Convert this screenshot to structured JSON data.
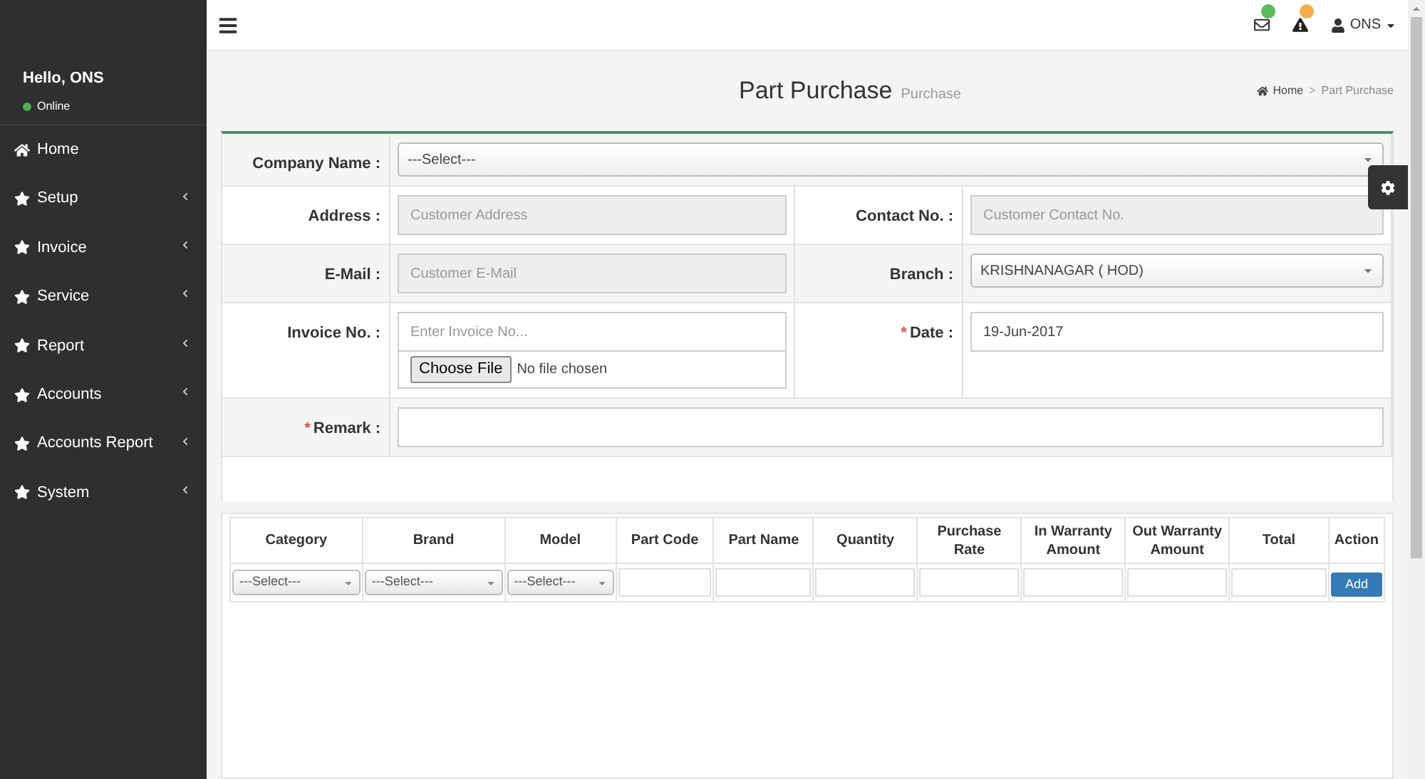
{
  "sidebar": {
    "greeting": "Hello, ONS",
    "status": {
      "label": "Online",
      "color": "#4caf50"
    },
    "items": [
      {
        "label": "Home",
        "kind": "home",
        "expandable": false
      },
      {
        "label": "Setup",
        "kind": "star",
        "expandable": true
      },
      {
        "label": "Invoice",
        "kind": "star",
        "expandable": true
      },
      {
        "label": "Service",
        "kind": "star",
        "expandable": true
      },
      {
        "label": "Report",
        "kind": "star",
        "expandable": true
      },
      {
        "label": "Accounts",
        "kind": "star",
        "expandable": true
      },
      {
        "label": "Accounts Report",
        "kind": "star",
        "expandable": true
      },
      {
        "label": "System",
        "kind": "star",
        "expandable": true
      }
    ]
  },
  "topbar": {
    "notifications": [
      {
        "kind": "mail",
        "color": "#5cb85c"
      },
      {
        "kind": "warning",
        "color": "#f0ad4e"
      }
    ],
    "user": "ONS"
  },
  "page": {
    "title": "Part Purchase",
    "subtitle": "Purchase",
    "breadcrumb_separator": ">",
    "breadcrumbs": [
      {
        "label": "Home",
        "kind": "home"
      },
      {
        "label": "Part Purchase",
        "kind": "current"
      }
    ]
  },
  "form": {
    "rows": [
      {
        "cells": [
          {
            "label": "Company Name :",
            "fields": [
              {
                "kind": "select",
                "value": "---Select---"
              }
            ]
          }
        ]
      },
      {
        "cells": [
          {
            "label": "Address :",
            "fields": [
              {
                "kind": "input",
                "placeholder": "Customer Address",
                "disabled": true
              }
            ]
          },
          {
            "label": "Contact No. :",
            "fields": [
              {
                "kind": "input",
                "placeholder": "Customer Contact No.",
                "disabled": true
              }
            ]
          }
        ]
      },
      {
        "cells": [
          {
            "label": "E-Mail :",
            "fields": [
              {
                "kind": "input",
                "placeholder": "Customer E-Mail",
                "disabled": true
              }
            ]
          },
          {
            "label": "Branch :",
            "fields": [
              {
                "kind": "select",
                "value": "KRISHNANAGAR ( HOD)"
              }
            ]
          }
        ]
      },
      {
        "cells": [
          {
            "label": "Invoice No. :",
            "fields": [
              {
                "kind": "input",
                "placeholder": "Enter Invoice No...",
                "disabled": false
              },
              {
                "kind": "file",
                "button": "Choose File",
                "status": "No file chosen"
              }
            ]
          },
          {
            "label": "Date :",
            "required_mark": "*",
            "fields": [
              {
                "kind": "input",
                "value": "19-Jun-2017",
                "disabled": false
              }
            ]
          }
        ]
      },
      {
        "cells": [
          {
            "label": "Remark :",
            "required_mark": "*",
            "fields": [
              {
                "kind": "input",
                "disabled": false
              }
            ]
          }
        ]
      }
    ]
  },
  "table": {
    "columns": [
      "Category",
      "Brand",
      "Model",
      "Part Code",
      "Part Name",
      "Quantity",
      "Purchase Rate",
      "In Warranty Amount",
      "Out Warranty Amount",
      "Total",
      "Action"
    ],
    "row": [
      {
        "kind": "select",
        "value": "---Select---"
      },
      {
        "kind": "select",
        "value": "---Select---"
      },
      {
        "kind": "select",
        "value": "---Select---"
      },
      {
        "kind": "input"
      },
      {
        "kind": "input"
      },
      {
        "kind": "input"
      },
      {
        "kind": "input"
      },
      {
        "kind": "input"
      },
      {
        "kind": "input"
      },
      {
        "kind": "input"
      },
      {
        "kind": "button",
        "label": "Add"
      }
    ]
  }
}
